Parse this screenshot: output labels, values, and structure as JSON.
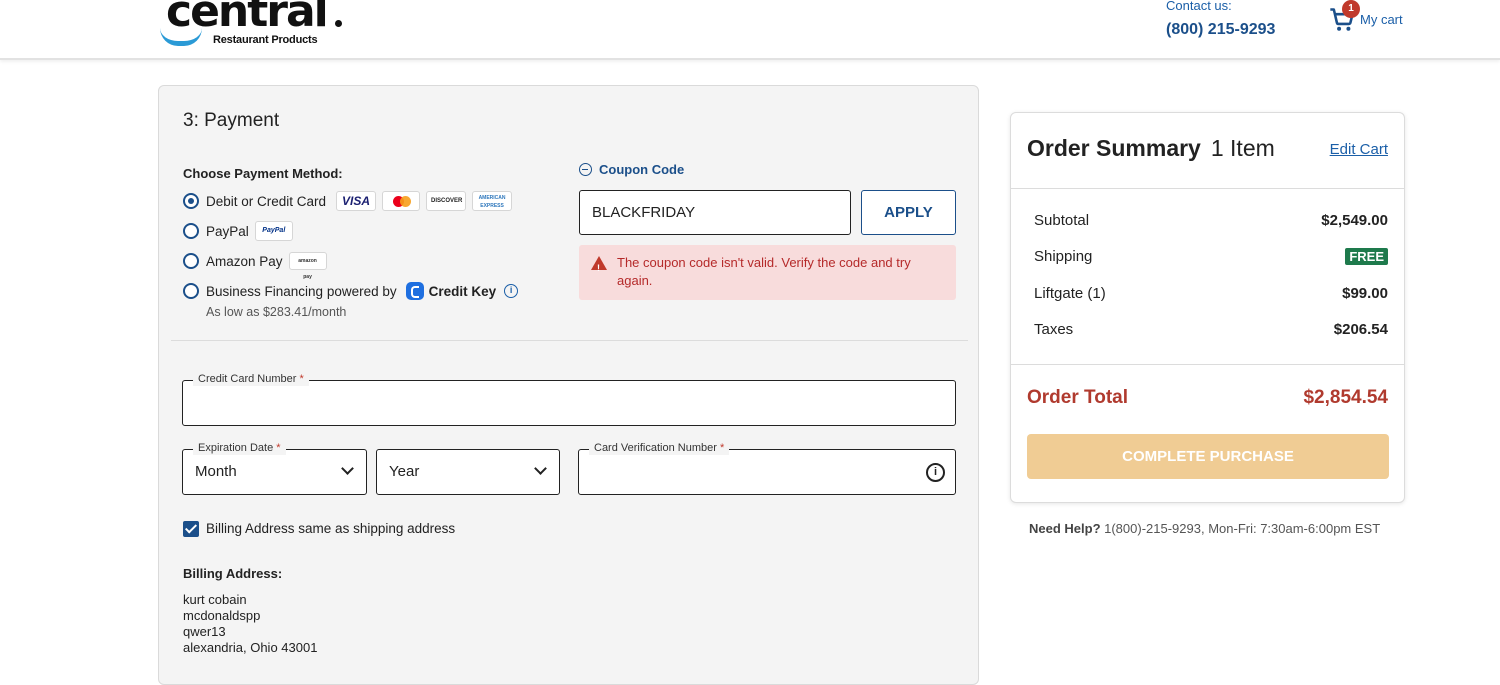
{
  "header": {
    "logo_word": "central",
    "logo_sub": "Restaurant Products",
    "contact_label": "Contact us:",
    "contact_phone": "(800) 215-9293",
    "cart_count": "1",
    "cart_label": "My cart"
  },
  "payment": {
    "title": "3: Payment",
    "method_heading": "Choose Payment Method:",
    "methods": [
      {
        "label": "Debit or Credit Card",
        "selected": true
      },
      {
        "label": "PayPal",
        "selected": false
      },
      {
        "label": "Amazon Pay",
        "selected": false
      },
      {
        "label": "Business Financing powered by",
        "selected": false
      }
    ],
    "card_logos": {
      "visa": "VISA",
      "discover": "DISCOVER",
      "amex": "AMERICAN EXPRESS",
      "paypal": "PayPal",
      "amazon": "amazon pay"
    },
    "credit_key": "Credit Key",
    "financing_note": "As low as $283.41/month",
    "coupon": {
      "link_label": "Coupon Code",
      "value": "BLACKFRIDAY",
      "apply_label": "APPLY",
      "error": "The coupon code isn't valid. Verify the code and try again."
    },
    "card_number_label": "Credit Card Number",
    "expiration_label": "Expiration Date",
    "month_value": "Month",
    "year_value": "Year",
    "cvn_label": "Card Verification Number",
    "required_mark": "*",
    "billing_same_label": "Billing Address same as shipping address",
    "billing_heading": "Billing Address:",
    "billing_lines": [
      "kurt cobain",
      "mcdonaldspp",
      "qwer13",
      "alexandria, Ohio 43001"
    ]
  },
  "summary": {
    "title": "Order Summary",
    "item_count": "1 Item",
    "edit_cart": "Edit Cart",
    "rows": [
      {
        "label": "Subtotal",
        "value": "$2,549.00"
      },
      {
        "label": "Shipping",
        "value": "FREE"
      },
      {
        "label": "Liftgate (1)",
        "value": "$99.00"
      },
      {
        "label": "Taxes",
        "value": "$206.54"
      }
    ],
    "total_label": "Order Total",
    "total_value": "$2,854.54",
    "complete_label": "COMPLETE PURCHASE"
  },
  "help": {
    "label": "Need Help?",
    "text": " 1(800)-215-9293, Mon-Fri: 7:30am-6:00pm EST"
  },
  "colors": {
    "brand_blue": "#1b4f8a",
    "error_red": "#b52a2a",
    "total_red": "#b03a2e",
    "free_green": "#1e7a4c",
    "disabled_orange": "#f0cc94"
  }
}
